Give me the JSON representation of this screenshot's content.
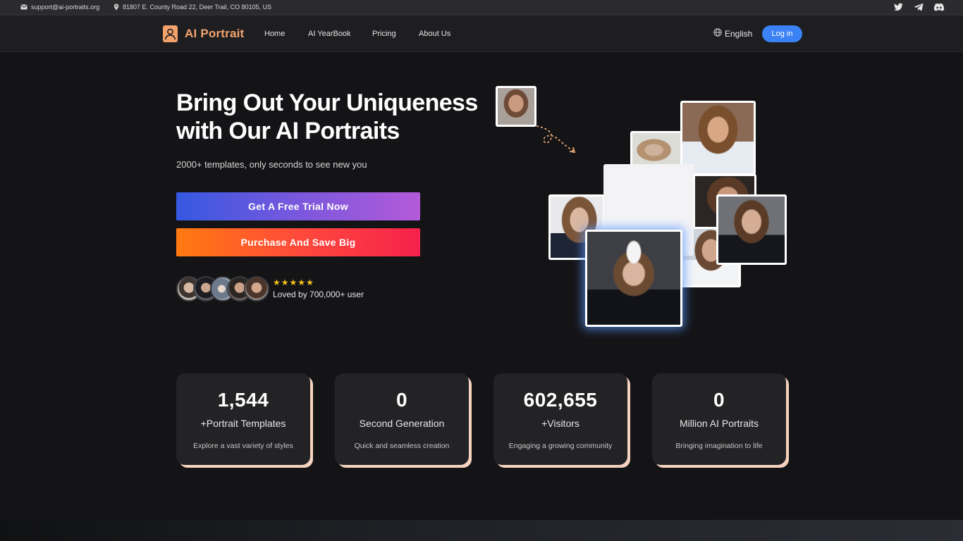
{
  "topbar": {
    "email": "support@ai-portraits.org",
    "address": "81807 E. County Road 22, Deer Trail, CO 80105, US",
    "social_icons": [
      "twitter-icon",
      "telegram-icon",
      "discord-icon"
    ]
  },
  "nav": {
    "brand": "AI Portrait",
    "brand_color": "#f4a46e",
    "items": [
      {
        "label": "Home"
      },
      {
        "label": "AI YearBook"
      },
      {
        "label": "Pricing"
      },
      {
        "label": "About Us"
      }
    ],
    "language": "English",
    "login": "Log in",
    "login_color": "#3a82f6"
  },
  "hero": {
    "title_line1": "Bring Out Your Uniqueness",
    "title_line2": "with Our AI Portraits",
    "subtitle": "2000+ templates, only seconds to see new you",
    "trial_button": "Get A Free Trial Now",
    "purchase_button": "Purchase And Save Big",
    "rating_stars": 5,
    "loved_text": "Loved by 700,000+ user"
  },
  "stats": [
    {
      "number": "1,544",
      "label": "+Portrait Templates",
      "desc": "Explore a vast variety of styles"
    },
    {
      "number": "0",
      "label": "Second Generation",
      "desc": "Quick and seamless creation"
    },
    {
      "number": "602,655",
      "label": "+Visitors",
      "desc": "Engaging a growing community"
    },
    {
      "number": "0",
      "label": "Million AI Portraits",
      "desc": "Bringing imagination to life"
    }
  ],
  "colors": {
    "stat_shadow": "#f6d3bf",
    "star": "#f7c21f"
  }
}
